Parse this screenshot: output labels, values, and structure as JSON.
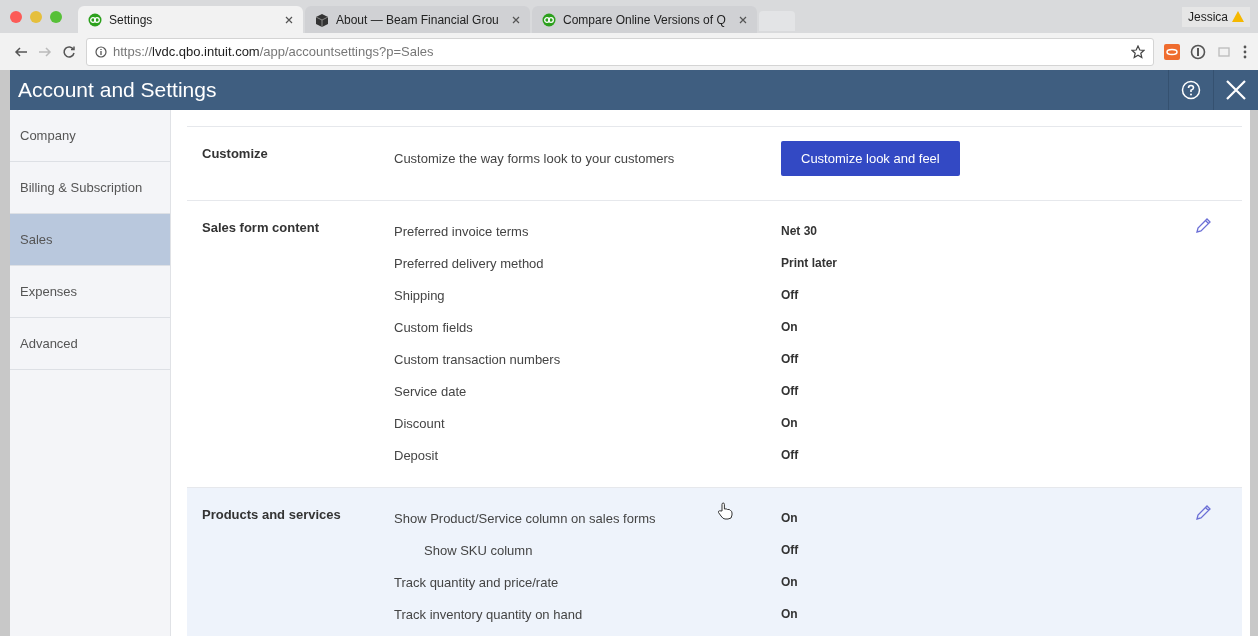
{
  "browser": {
    "tabs": [
      {
        "title": "Settings",
        "selected": true
      },
      {
        "title": "About — Beam Financial Grou",
        "selected": false
      },
      {
        "title": "Compare Online Versions of Q",
        "selected": false
      }
    ],
    "profile": "Jessica",
    "url": {
      "scheme": "https://",
      "host": "lvdc.qbo.intuit.com",
      "path": "/app/accountsettings?p=Sales"
    }
  },
  "header": {
    "title": "Account and Settings"
  },
  "sidebar": {
    "items": [
      {
        "label": "Company",
        "selected": false
      },
      {
        "label": "Billing & Subscription",
        "selected": false
      },
      {
        "label": "Sales",
        "selected": true
      },
      {
        "label": "Expenses",
        "selected": false
      },
      {
        "label": "Advanced",
        "selected": false
      }
    ]
  },
  "sections": [
    {
      "title": "Customize",
      "highlighted": false,
      "description": "Customize the way forms look to your customers",
      "button": "Customize look and feel"
    },
    {
      "title": "Sales form content",
      "highlighted": false,
      "editable": true,
      "settings": [
        {
          "label": "Preferred invoice terms",
          "value": "Net 30"
        },
        {
          "label": "Preferred delivery method",
          "value": "Print later"
        },
        {
          "label": "Shipping",
          "value": "Off"
        },
        {
          "label": "Custom fields",
          "value": "On"
        },
        {
          "label": "Custom transaction numbers",
          "value": "Off"
        },
        {
          "label": "Service date",
          "value": "Off"
        },
        {
          "label": "Discount",
          "value": "On"
        },
        {
          "label": "Deposit",
          "value": "Off"
        }
      ]
    },
    {
      "title": "Products and services",
      "highlighted": true,
      "editable": true,
      "settings": [
        {
          "label": "Show Product/Service column on sales forms",
          "value": "On",
          "children": [
            {
              "label": "Show SKU column",
              "value": "Off"
            }
          ]
        },
        {
          "label": "Track quantity and price/rate",
          "value": "On"
        },
        {
          "label": "Track inventory quantity on hand",
          "value": "On"
        }
      ]
    }
  ]
}
